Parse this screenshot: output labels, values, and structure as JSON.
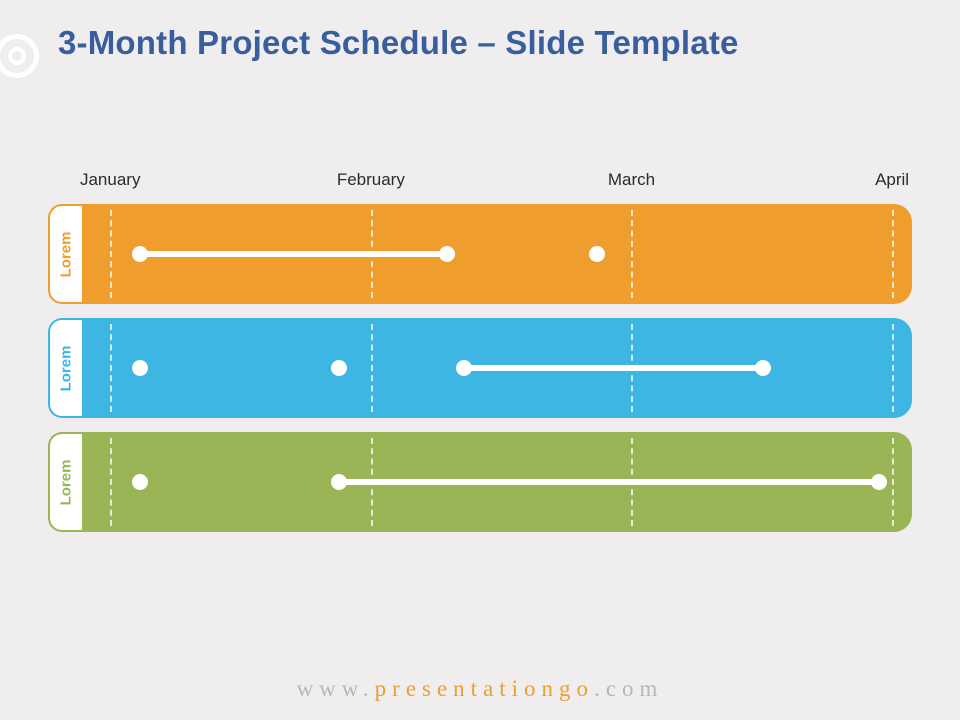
{
  "title": "3-Month Project Schedule – Slide Template",
  "months": [
    "January",
    "February",
    "March",
    "April"
  ],
  "rows": [
    {
      "label": "Lorem",
      "color": "orange"
    },
    {
      "label": "Lorem",
      "color": "blue"
    },
    {
      "label": "Lorem",
      "color": "green"
    }
  ],
  "chart_data": {
    "type": "bar",
    "title": "3-Month Project Schedule",
    "xlabel": "",
    "ylabel": "",
    "x_ticks": [
      "January",
      "February",
      "March",
      "April"
    ],
    "x_range_percent": [
      3.4,
      97.6
    ],
    "series": [
      {
        "name": "Lorem",
        "color": "#ef9e2e",
        "segments": [
          {
            "start_pct": 7.0,
            "end_pct": 44.0
          },
          {
            "start_pct": 62.0,
            "end_pct": 62.0
          }
        ]
      },
      {
        "name": "Lorem",
        "color": "#3db6e3",
        "segments": [
          {
            "start_pct": 7.0,
            "end_pct": 7.0
          },
          {
            "start_pct": 31.0,
            "end_pct": 31.0
          },
          {
            "start_pct": 46.0,
            "end_pct": 82.0
          }
        ]
      },
      {
        "name": "Lorem",
        "color": "#99b556",
        "segments": [
          {
            "start_pct": 7.0,
            "end_pct": 7.0
          },
          {
            "start_pct": 31.0,
            "end_pct": 96.0
          }
        ]
      }
    ],
    "grid_positions_pct": [
      3.4,
      34.8,
      66.2,
      97.6
    ]
  },
  "footer": {
    "pre": "www.",
    "mid": "presentationgo",
    "post": ".com"
  },
  "colors": {
    "orange": "#ef9e2e",
    "blue": "#3db6e3",
    "green": "#99b556",
    "title": "#385e9d"
  }
}
